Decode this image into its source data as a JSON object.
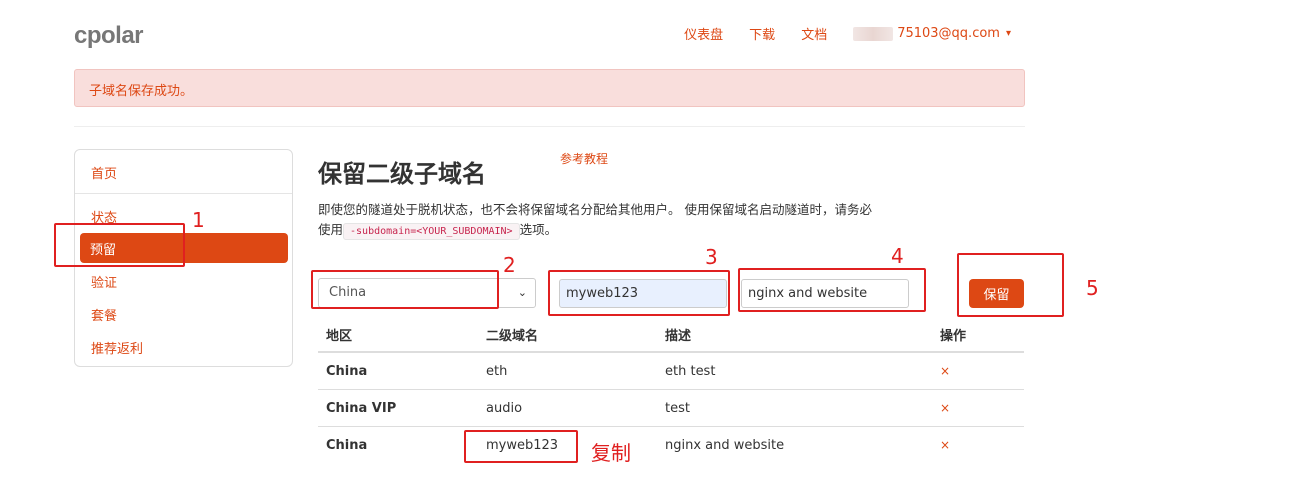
{
  "header": {
    "logo": "cpolar",
    "nav": [
      "仪表盘",
      "下载",
      "文档"
    ],
    "user_email": "75103@qq.com"
  },
  "alert": {
    "message": "子域名保存成功。"
  },
  "sidebar": {
    "items": [
      "首页",
      "状态",
      "预留",
      "验证",
      "套餐",
      "推荐返利"
    ],
    "active": "预留"
  },
  "main": {
    "title": "保留二级子域名",
    "ref_link": "参考教程",
    "desc_before": "即使您的隧道处于脱机状态，也不会将保留域名分配给其他用户。 使用保留域名启动隧道时，请务必使用",
    "desc_code": "-subdomain=<YOUR_SUBDOMAIN>",
    "desc_after": "选项。"
  },
  "form": {
    "region_value": "China",
    "subdomain_value": "myweb123",
    "description_value": "nginx and website",
    "save_label": "保留"
  },
  "table": {
    "headers": [
      "地区",
      "二级域名",
      "描述",
      "操作"
    ],
    "rows": [
      {
        "region": "China",
        "subdomain": "eth",
        "description": "eth test",
        "action": "×"
      },
      {
        "region": "China VIP",
        "subdomain": "audio",
        "description": "test",
        "action": "×"
      },
      {
        "region": "China",
        "subdomain": "myweb123",
        "description": "nginx and website",
        "action": "×"
      }
    ]
  },
  "annotations": {
    "numbers": [
      "1",
      "2",
      "3",
      "4",
      "5"
    ],
    "copy_label": "复制"
  },
  "colors": {
    "accent": "#dd4814",
    "annotation": "#e02020",
    "alert_bg": "#f9dedc"
  }
}
